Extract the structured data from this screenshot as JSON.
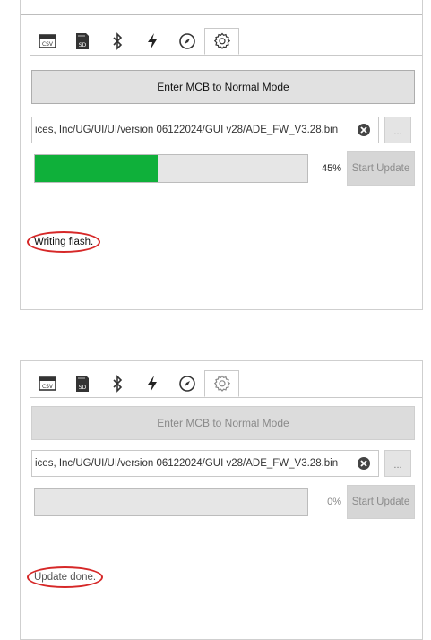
{
  "panels": [
    {
      "tabs": [
        {
          "icon": "csv-file-icon"
        },
        {
          "icon": "sd-card-icon"
        },
        {
          "icon": "bluetooth-icon"
        },
        {
          "icon": "lightning-icon"
        },
        {
          "icon": "compass-icon"
        },
        {
          "icon": "gear-icon",
          "active": true
        }
      ],
      "mode_button": "Enter MCB to Normal Mode",
      "file_path": "ices, Inc/UG/UI/UI/version 06122024/GUI v28/ADE_FW_V3.28.bin",
      "browse_label": "...",
      "progress_fraction": 0.45,
      "progress_text": "45%",
      "start_button": "Start Update",
      "status_text": "Writing flash."
    },
    {
      "tabs": [
        {
          "icon": "csv-file-icon"
        },
        {
          "icon": "sd-card-icon"
        },
        {
          "icon": "bluetooth-icon"
        },
        {
          "icon": "lightning-icon"
        },
        {
          "icon": "compass-icon"
        },
        {
          "icon": "gear-icon",
          "active": true
        }
      ],
      "mode_button": "Enter MCB to Normal Mode",
      "file_path": "ices, Inc/UG/UI/UI/version 06122024/GUI v28/ADE_FW_V3.28.bin",
      "browse_label": "...",
      "progress_fraction": 0.0,
      "progress_text": "0%",
      "start_button": "Start Update",
      "status_text": "Update done."
    }
  ],
  "colors": {
    "progress_green": "#0fb03a",
    "status_ring": "#d62828"
  }
}
